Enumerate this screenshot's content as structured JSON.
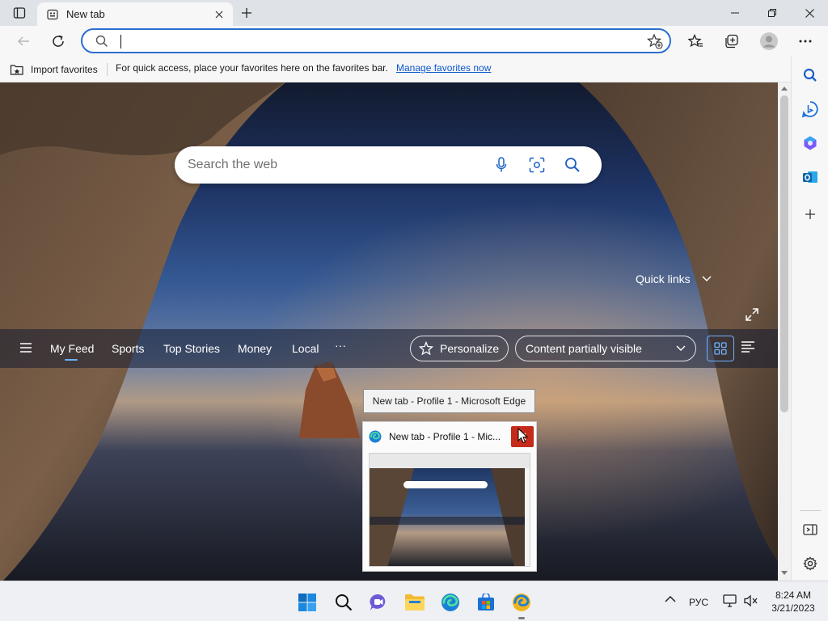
{
  "browser": {
    "tab": {
      "title": "New tab"
    },
    "omnibox": {
      "value": "",
      "placeholder": ""
    },
    "favorites_bar": {
      "import_label": "Import favorites",
      "message": "For quick access, place your favorites here on the favorites bar.",
      "manage_link": "Manage favorites now"
    }
  },
  "newtab": {
    "search_placeholder": "Search the web",
    "quick_links_label": "Quick links",
    "feed_tabs": [
      {
        "label": "My Feed",
        "active": true
      },
      {
        "label": "Sports"
      },
      {
        "label": "Top Stories"
      },
      {
        "label": "Money"
      },
      {
        "label": "Local"
      }
    ],
    "more_label": "···",
    "personalize_label": "Personalize",
    "content_visibility_label": "Content partially visible"
  },
  "taskbar_preview": {
    "tooltip": "New tab - Profile 1 - Microsoft Edge",
    "title": "New tab - Profile 1 - Mic..."
  },
  "system_tray": {
    "language": "РУС",
    "time": "8:24 AM",
    "date": "3/21/2023"
  },
  "colors": {
    "accent": "#2b6fcf",
    "close_red": "#c42b1c",
    "link": "#0b57d0"
  }
}
